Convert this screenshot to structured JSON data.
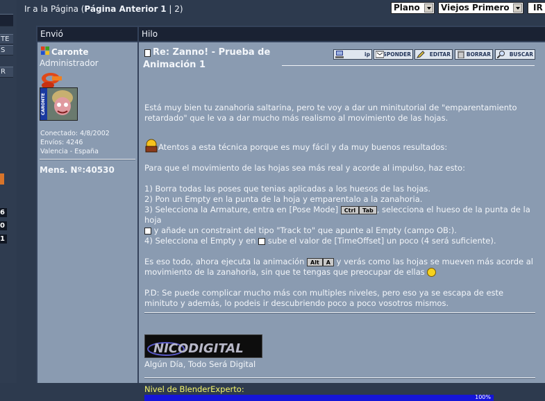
{
  "nav": {
    "prefix": "Ir a la Página (",
    "prev_label": "Página Anterior",
    "page_current": "1",
    "sep": " | ",
    "page_next": "2",
    "suffix": ")"
  },
  "controls": {
    "view_mode": "Plano",
    "sort_order": "Viejos Primero",
    "go_label": "IR"
  },
  "left_strip": {
    "labels": [
      "TE",
      "S",
      "R"
    ],
    "numbers": [
      "6",
      "0",
      "1"
    ]
  },
  "table": {
    "col_sender": "Envió",
    "col_thread": "Hilo"
  },
  "author": {
    "name": "Caronte",
    "role": "Administrador",
    "connected": "Conectado: 4/8/2002",
    "posts": "Envíos: 4246",
    "location": "Valencia - España",
    "message_number": "Mens. Nº:40530",
    "avatar_text": "CARONTE"
  },
  "post": {
    "title": "Re: Zanno! - Prueba de Animación 1",
    "actions": {
      "ip": "ip",
      "reply": "RESPONDER",
      "edit": "EDITAR",
      "delete": "BORRAR",
      "search": "BUSCAR"
    },
    "body": {
      "p1": "Está muy bien tu zanahoria saltarina, pero te voy a dar un minitutorial de \"emparentamiento retardado\" que le va a dar mucho más realismo al movimiento de las hojas.",
      "p2": "Atentos a esta técnica porque es muy fácil y da muy buenos resultados:",
      "p3": "Para que el movimiento de las hojas sea más real y acorde al impulso, haz esto:",
      "s1": "1) Borra todas las poses que tenias aplicadas a los huesos de las hojas.",
      "s2": "2) Pon un Empty en la punta de la hoja y emparentalo a la zanahoria.",
      "s3a": "3) Selecciona la Armature, entra en [Pose Mode]",
      "s3b": ", selecciona el hueso de la punta de la hoja",
      "s3c": "y añade un constraint del tipo \"Track to\" que apunte al Empty (campo OB:).",
      "s4a": "4) Selecciona el Empty y en",
      "s4b": "sube el valor de [TimeOffset] un poco (4 será suficiente).",
      "p5a": "Es eso todo, ahora ejecuta la animación",
      "p5b": "y verás como las hojas se mueven más acorde al movimiento de la zanahoria, sin que te tengas que preocupar de ellas",
      "p6": "P.D: Se puede complicar mucho más con multiples niveles, pero eso ya se escapa de este minituto y además, lo podeis ir descubriendo poco a poco vosotros mismos.",
      "key_ctrl": "Ctrl",
      "key_tab": "Tab",
      "key_alt": "Alt",
      "key_a": "A"
    },
    "signature": {
      "logo_text": "NICODIGITAL",
      "tagline": "Algún Día, Todo Será Digital"
    },
    "level": {
      "label": "Nivel de BlenderExperto:",
      "percent_text": "100%",
      "fraction": 1.0
    }
  },
  "colors": {
    "background": "#2d3a4e",
    "cell": "#8a9bb1",
    "header": "#1a2233",
    "level_bar": "#1515d8",
    "level_label": "#f6f66a"
  }
}
